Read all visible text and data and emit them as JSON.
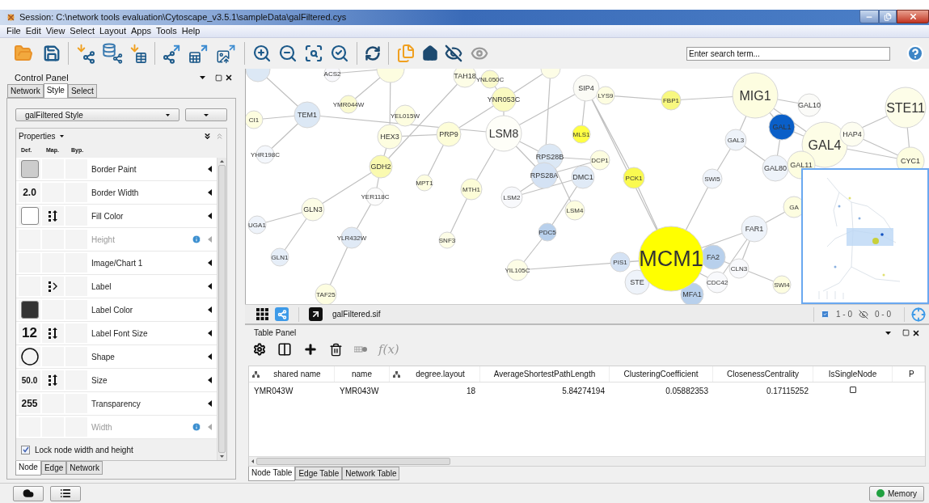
{
  "window": {
    "title": "Session: C:\\network tools evaluation\\Cytoscape_v3.5.1\\sampleData\\galFiltered.cys"
  },
  "menu": [
    "File",
    "Edit",
    "View",
    "Select",
    "Layout",
    "Apps",
    "Tools",
    "Help"
  ],
  "search": {
    "placeholder": "Enter search term..."
  },
  "control_panel": {
    "title": "Control Panel",
    "tabs": [
      {
        "label": "Network",
        "selected": false
      },
      {
        "label": "Style",
        "selected": true
      },
      {
        "label": "Select",
        "selected": false
      }
    ],
    "style_name": "galFiltered Style",
    "section": "Properties",
    "columns": [
      "Def.",
      "Map.",
      "Byp."
    ],
    "properties": [
      {
        "name": "Border Paint",
        "def": {
          "kind": "swatch",
          "color": "#cccccc"
        },
        "disabled": false
      },
      {
        "name": "Border Width",
        "def": {
          "kind": "value",
          "text": "2.0"
        },
        "disabled": false
      },
      {
        "name": "Fill Color",
        "def": {
          "kind": "swatch",
          "color": "#ffffff"
        },
        "mapping": {
          "kind": "continuous"
        },
        "disabled": false
      },
      {
        "name": "Height",
        "disabled": true
      },
      {
        "name": "Image/Chart 1",
        "disabled": false
      },
      {
        "name": "Label",
        "mapping": {
          "kind": "passthrough"
        },
        "disabled": false
      },
      {
        "name": "Label Color",
        "def": {
          "kind": "swatch",
          "color": "#333333"
        },
        "disabled": false
      },
      {
        "name": "Label Font Size",
        "def": {
          "kind": "value",
          "text": "12"
        },
        "mapping": {
          "kind": "continuous"
        },
        "disabled": false
      },
      {
        "name": "Shape",
        "def": {
          "kind": "circle"
        },
        "disabled": false
      },
      {
        "name": "Size",
        "def": {
          "kind": "value",
          "text": "50.0"
        },
        "mapping": {
          "kind": "continuous"
        },
        "disabled": false
      },
      {
        "name": "Transparency",
        "def": {
          "kind": "value",
          "text": "255"
        },
        "disabled": false
      },
      {
        "name": "Width",
        "disabled": true
      }
    ],
    "lock": {
      "label": "Lock node width and height",
      "checked": true
    },
    "bottom_tabs": [
      {
        "label": "Node",
        "selected": true
      },
      {
        "label": "Edge",
        "selected": false
      },
      {
        "label": "Network",
        "selected": false
      }
    ]
  },
  "network_view": {
    "nodes": [
      {
        "color": "#dce8f5"
      },
      {
        "label": "ACS2",
        "color": "#f8f8fc"
      },
      {
        "color": "#fdfde0"
      },
      {
        "label": "TAH18",
        "color": "#fdfde6"
      },
      {
        "label": "YNL050C",
        "color": "#fafacc"
      },
      {
        "color": "#fdfde6"
      },
      {
        "label": "SIP4",
        "color": "#fbfbf5"
      },
      {
        "label": "LYS9",
        "color": "#fdfde0"
      },
      {
        "label": "TEM1",
        "color": "#dce8f5"
      },
      {
        "label": "YMR044W",
        "color": "#fafad0"
      },
      {
        "label": "CI1",
        "color": "#fdfde0"
      },
      {
        "label": "YEL015W",
        "color": "#fdfde0"
      },
      {
        "label": "YNR053C",
        "color": "#fafac0"
      },
      {
        "label": "LSM8",
        "color": "#fefef8"
      },
      {
        "label": "MLS1",
        "color": "#ffff44"
      },
      {
        "label": "HEX3",
        "color": "#fdfde0"
      },
      {
        "label": "PRP9",
        "color": "#fdfdd8"
      },
      {
        "label": "YHR198C",
        "color": "#f4f7fc"
      },
      {
        "label": "GDH2",
        "color": "#fafab0"
      },
      {
        "label": "RPS28B",
        "color": "#dce8f5"
      },
      {
        "label": "RPS28A",
        "color": "#d4e2f4"
      },
      {
        "label": "DMC1",
        "color": "#e0eaf6"
      },
      {
        "label": "DCP1",
        "color": "#fdfde0"
      },
      {
        "label": "MPT1",
        "color": "#fdfde0"
      },
      {
        "label": "YER118C",
        "color": "#fcfcfc"
      },
      {
        "label": "MTH1",
        "color": "#fdfdd8"
      },
      {
        "label": "LSM2",
        "color": "#f8f9fc"
      },
      {
        "label": "LSM4",
        "color": "#fdfde0"
      },
      {
        "label": "GLN3",
        "color": "#fdfde6"
      },
      {
        "label": "UGA1",
        "color": "#eef3fa"
      },
      {
        "label": "PDC5",
        "color": "#b8d0ec"
      },
      {
        "label": "YLR432W",
        "color": "#e0eaf6"
      },
      {
        "label": "SNF3",
        "color": "#fdfde6"
      },
      {
        "label": "GLN1",
        "color": "#e6eef8"
      },
      {
        "label": "YIL105C",
        "color": "#fdfde6"
      },
      {
        "label": "TAF25",
        "color": "#fdfde0"
      },
      {
        "label": "FBP1",
        "color": "#f8f880"
      },
      {
        "label": "MIG1",
        "color": "#fdfde0"
      },
      {
        "label": "GAL10",
        "color": "#fbfbf8"
      },
      {
        "label": "STE11",
        "color": "#fdfde8"
      },
      {
        "label": "GAL1",
        "color": "#0a5fc8"
      },
      {
        "label": "GAL3",
        "color": "#eef3fa"
      },
      {
        "label": "GAL4",
        "color": "#fdfde6"
      },
      {
        "label": "HAP4",
        "color": "#fdfdf0"
      },
      {
        "label": "GAL80",
        "color": "#eef3fa"
      },
      {
        "label": "GAL11",
        "color": "#fdfde0"
      },
      {
        "label": "CYC1",
        "color": "#fdfde0"
      },
      {
        "label": "PCK1",
        "color": "#fafa50"
      },
      {
        "label": "SWI5",
        "color": "#eef3fa"
      },
      {
        "label": "GA",
        "color": "#fdfde0"
      },
      {
        "label": "FAR1",
        "color": "#eef3fa"
      },
      {
        "label": "PIS1",
        "color": "#d4e2f4"
      },
      {
        "label": "STE",
        "color": "#eef3fa"
      },
      {
        "label": "FA2",
        "color": "#b8d0ec"
      },
      {
        "label": "CLN3",
        "color": "#f8f9fc"
      },
      {
        "label": "CDC42",
        "color": "#f8f9fc"
      },
      {
        "label": "SWI4",
        "color": "#fdfde0"
      },
      {
        "label": "MFA1",
        "color": "#b8d0ec"
      },
      {
        "label": "MCM1",
        "color": "#ffff00"
      }
    ],
    "file": "galFiltered.sif",
    "selected_count": "1 - 0",
    "hidden_count": "0 - 0"
  },
  "table_panel": {
    "title": "Table Panel",
    "formula": "f(x)",
    "columns": [
      {
        "label": "shared name",
        "icon": true
      },
      {
        "label": "name",
        "icon": false
      },
      {
        "label": "degree.layout",
        "icon": true
      },
      {
        "label": "AverageShortestPathLength",
        "icon": false
      },
      {
        "label": "ClusteringCoefficient",
        "icon": false
      },
      {
        "label": "ClosenessCentrality",
        "icon": false
      },
      {
        "label": "IsSingleNode",
        "icon": false
      },
      {
        "label": "P",
        "icon": false
      }
    ],
    "rows": [
      {
        "cells": [
          {
            "kind": "text",
            "text": "YMR043W"
          },
          {
            "kind": "text",
            "text": "YMR043W"
          },
          {
            "kind": "number",
            "text": "18"
          },
          {
            "kind": "number",
            "text": "5.84274194"
          },
          {
            "kind": "number",
            "text": "0.05882353"
          },
          {
            "kind": "number",
            "text": "0.17115252"
          },
          {
            "kind": "checkbox",
            "checked": false
          }
        ]
      }
    ],
    "tabs": [
      {
        "label": "Node Table",
        "selected": true
      },
      {
        "label": "Edge Table",
        "selected": false
      },
      {
        "label": "Network Table",
        "selected": false
      }
    ]
  },
  "status_bar": {
    "memory": "Memory"
  }
}
